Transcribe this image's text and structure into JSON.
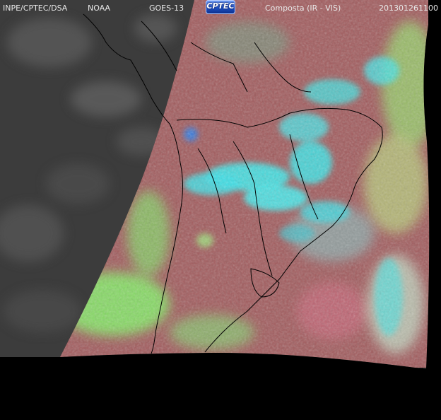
{
  "header": {
    "source": "INPE/CPTEC/DSA",
    "agency": "NOAA",
    "satellite": "GOES-13",
    "logo_text": "CPTEC",
    "product": "Composta (IR - VIS)",
    "timestamp": "201301261100"
  },
  "colors": {
    "background": "#000000",
    "night_ir": "#3e3e3e",
    "land_red": "#a55a5a",
    "high_cloud": "#38e8ea",
    "low_cloud_green": "#84e86a",
    "yellow_green": "#b6c27a",
    "borders": "#000000"
  },
  "icons": {
    "logo": "cptec-logo"
  }
}
